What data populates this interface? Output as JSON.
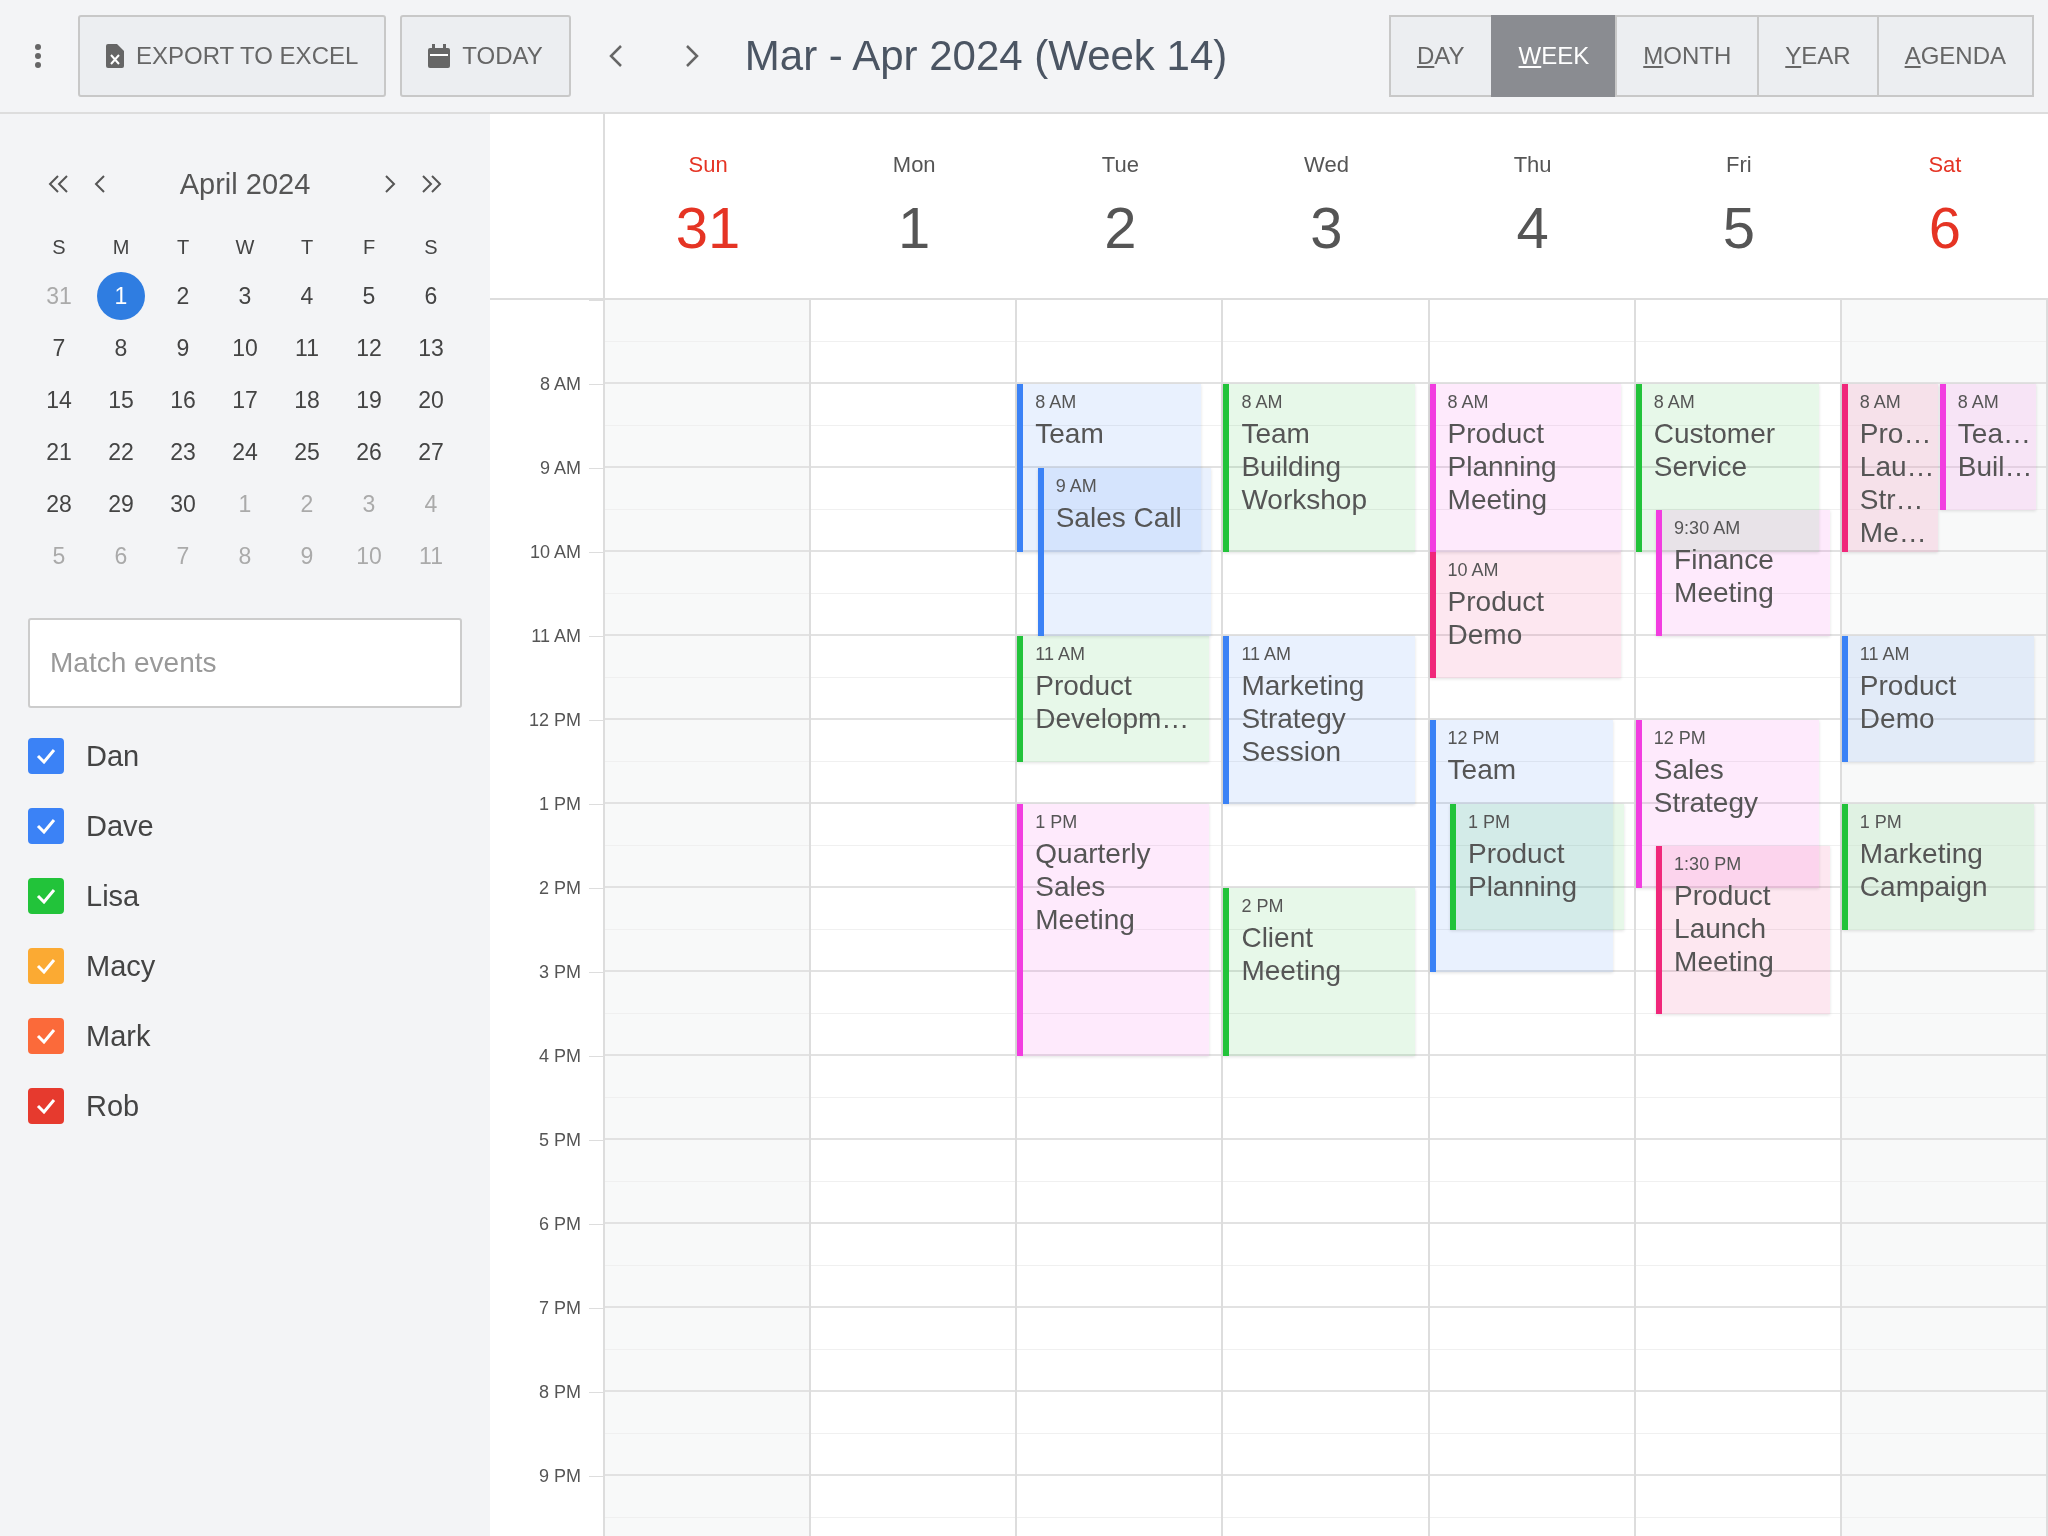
{
  "toolbar": {
    "export_button": "EXPORT TO EXCEL",
    "today_button": "TODAY",
    "title": "Mar - Apr 2024 (Week 14)",
    "views": [
      {
        "label": "DAY",
        "selected": false
      },
      {
        "label": "WEEK",
        "selected": true
      },
      {
        "label": "MONTH",
        "selected": false
      },
      {
        "label": "YEAR",
        "selected": false
      },
      {
        "label": "AGENDA",
        "selected": false
      }
    ]
  },
  "mini_calendar": {
    "title": "April 2024",
    "weekdays": [
      "S",
      "M",
      "T",
      "W",
      "T",
      "F",
      "S"
    ],
    "weeks": [
      [
        {
          "day": "31",
          "muted": true,
          "selected": false
        },
        {
          "day": "1",
          "muted": false,
          "selected": true
        },
        {
          "day": "2",
          "muted": false,
          "selected": false
        },
        {
          "day": "3",
          "muted": false,
          "selected": false
        },
        {
          "day": "4",
          "muted": false,
          "selected": false
        },
        {
          "day": "5",
          "muted": false,
          "selected": false
        },
        {
          "day": "6",
          "muted": false,
          "selected": false
        }
      ],
      [
        {
          "day": "7",
          "muted": false,
          "selected": false
        },
        {
          "day": "8",
          "muted": false,
          "selected": false
        },
        {
          "day": "9",
          "muted": false,
          "selected": false
        },
        {
          "day": "10",
          "muted": false,
          "selected": false
        },
        {
          "day": "11",
          "muted": false,
          "selected": false
        },
        {
          "day": "12",
          "muted": false,
          "selected": false
        },
        {
          "day": "13",
          "muted": false,
          "selected": false
        }
      ],
      [
        {
          "day": "14",
          "muted": false,
          "selected": false
        },
        {
          "day": "15",
          "muted": false,
          "selected": false
        },
        {
          "day": "16",
          "muted": false,
          "selected": false
        },
        {
          "day": "17",
          "muted": false,
          "selected": false
        },
        {
          "day": "18",
          "muted": false,
          "selected": false
        },
        {
          "day": "19",
          "muted": false,
          "selected": false
        },
        {
          "day": "20",
          "muted": false,
          "selected": false
        }
      ],
      [
        {
          "day": "21",
          "muted": false,
          "selected": false
        },
        {
          "day": "22",
          "muted": false,
          "selected": false
        },
        {
          "day": "23",
          "muted": false,
          "selected": false
        },
        {
          "day": "24",
          "muted": false,
          "selected": false
        },
        {
          "day": "25",
          "muted": false,
          "selected": false
        },
        {
          "day": "26",
          "muted": false,
          "selected": false
        },
        {
          "day": "27",
          "muted": false,
          "selected": false
        }
      ],
      [
        {
          "day": "28",
          "muted": false,
          "selected": false
        },
        {
          "day": "29",
          "muted": false,
          "selected": false
        },
        {
          "day": "30",
          "muted": false,
          "selected": false
        },
        {
          "day": "1",
          "muted": true,
          "selected": false
        },
        {
          "day": "2",
          "muted": true,
          "selected": false
        },
        {
          "day": "3",
          "muted": true,
          "selected": false
        },
        {
          "day": "4",
          "muted": true,
          "selected": false
        }
      ],
      [
        {
          "day": "5",
          "muted": true,
          "selected": false
        },
        {
          "day": "6",
          "muted": true,
          "selected": false
        },
        {
          "day": "7",
          "muted": true,
          "selected": false
        },
        {
          "day": "8",
          "muted": true,
          "selected": false
        },
        {
          "day": "9",
          "muted": true,
          "selected": false
        },
        {
          "day": "10",
          "muted": true,
          "selected": false
        },
        {
          "day": "11",
          "muted": true,
          "selected": false
        }
      ]
    ]
  },
  "search": {
    "placeholder": "Match events"
  },
  "people": [
    {
      "name": "Dan",
      "checked": true,
      "color": "#3b82f6"
    },
    {
      "name": "Dave",
      "checked": true,
      "color": "#3b82f6"
    },
    {
      "name": "Lisa",
      "checked": true,
      "color": "#22c33a"
    },
    {
      "name": "Macy",
      "checked": true,
      "color": "#fbaa33"
    },
    {
      "name": "Mark",
      "checked": true,
      "color": "#fb6a3a"
    },
    {
      "name": "Rob",
      "checked": true,
      "color": "#e63a2e"
    }
  ],
  "time_labels": [
    "8 AM",
    "9 AM",
    "10 AM",
    "11 AM",
    "12 PM",
    "1 PM",
    "2 PM",
    "3 PM",
    "4 PM",
    "5 PM",
    "6 PM",
    "7 PM",
    "8 PM",
    "9 PM"
  ],
  "days": [
    {
      "name": "Sun",
      "date": "31",
      "weekend": true
    },
    {
      "name": "Mon",
      "date": "1",
      "weekend": false
    },
    {
      "name": "Tue",
      "date": "2",
      "weekend": false,
      "events": [
        {
          "time": "8 AM",
          "kind": "medium",
          "title": "Team",
          "color": "#3b82f6"
        },
        {
          "time": "9 AM",
          "kind": "medium",
          "title": "Sales Call",
          "color": "#3b82f6"
        },
        {
          "time": "11 AM",
          "kind": "short",
          "title": "Product Developm…",
          "color": "#22c33a"
        },
        {
          "time": "1 PM",
          "kind": "long",
          "title": "Quarterly Sales Meeting",
          "color": "#f23de0"
        }
      ]
    },
    {
      "name": "Wed",
      "date": "3",
      "weekend": false,
      "events": [
        {
          "time": "8 AM",
          "kind": "medium",
          "title": "Team Building Workshop",
          "color": "#22c33a"
        },
        {
          "time": "11 AM",
          "kind": "medium",
          "title": "Marketing Strategy Session",
          "color": "#3b82f6"
        },
        {
          "time": "2 PM",
          "kind": "medium",
          "title": "Client Meeting",
          "color": "#22c33a"
        }
      ]
    },
    {
      "name": "Thu",
      "date": "4",
      "weekend": false,
      "events": [
        {
          "time": "8 AM",
          "kind": "medium",
          "title": "Product Planning Meeting",
          "color": "#f23de0"
        },
        {
          "time": "10 AM",
          "kind": "short",
          "title": "Product Demo",
          "color": "#f0277a"
        },
        {
          "time": "12 PM",
          "kind": "long",
          "title": "Team",
          "color": "#3b82f6"
        },
        {
          "time": "1 PM",
          "kind": "short",
          "title": "Product Planning",
          "color": "#22c33a"
        }
      ]
    },
    {
      "name": "Fri",
      "date": "5",
      "weekend": false,
      "events": [
        {
          "time": "8 AM",
          "kind": "medium",
          "title": "Customer Service",
          "color": "#22c33a"
        },
        {
          "time": "9:30 AM",
          "kind": "short",
          "title": "Finance Meeting",
          "color": "#f23de0"
        },
        {
          "time": "12 PM",
          "kind": "medium",
          "title": "Sales Strategy",
          "color": "#f23de0"
        },
        {
          "time": "1:30 PM",
          "kind": "medium",
          "title": "Product Launch Meeting",
          "color": "#f0277a"
        }
      ]
    },
    {
      "name": "Sat",
      "date": "6",
      "weekend": true,
      "events": [
        {
          "time": "8 AM",
          "kind": "medium",
          "title": "Pro… Lau… Str… Me…",
          "color": "#f0277a"
        },
        {
          "time": "8 AM",
          "kind": "short",
          "title": "Tea… Buil…",
          "color": "#f23de0"
        },
        {
          "time": "11 AM",
          "kind": "short",
          "title": "Product Demo",
          "color": "#3b82f6"
        },
        {
          "time": "1 PM",
          "kind": "short",
          "title": "Marketing Campaign",
          "color": "#22c33a"
        }
      ]
    }
  ]
}
